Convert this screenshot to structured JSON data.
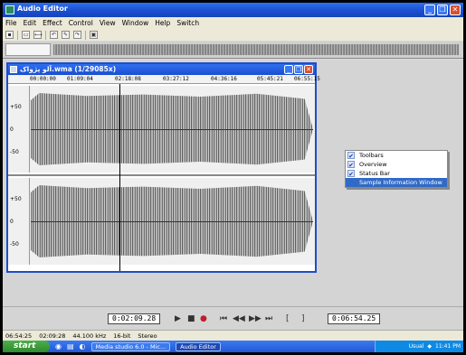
{
  "window": {
    "title": "Audio Editor"
  },
  "menu": [
    "File",
    "Edit",
    "Effect",
    "Control",
    "View",
    "Window",
    "Help",
    "Switch"
  ],
  "child": {
    "title": "آلو پژواک.wma (1/29085x)",
    "ruler": [
      "00:00:00",
      "01:09:04",
      "02:18:08",
      "03:27:12",
      "04:36:16",
      "05:45:21",
      "06:55:15"
    ],
    "axis_labels": [
      "+50",
      "0",
      "-50"
    ]
  },
  "context_menu": {
    "items": [
      {
        "label": "Toolbars",
        "checked": true
      },
      {
        "label": "Overview",
        "checked": true
      },
      {
        "label": "Status Bar",
        "checked": true
      },
      {
        "label": "Sample Information Window",
        "checked": false
      }
    ]
  },
  "transport": {
    "position": "0:02:09.28",
    "length": "0:06:54.25"
  },
  "status": [
    "06:54:25",
    "02:09:28",
    "44.100 kHz",
    "16-bit",
    "Stereo"
  ],
  "taskbar": {
    "start": "start",
    "tasks": [
      "Media studio 6.0 - Mic...",
      "Audio Editor"
    ],
    "tray_text": "Usual",
    "clock": "11:41 PM"
  }
}
